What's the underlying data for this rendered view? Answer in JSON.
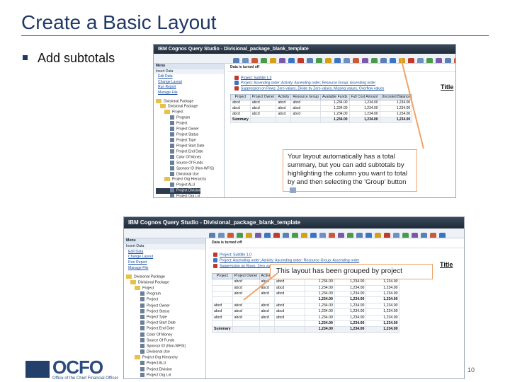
{
  "slide": {
    "title": "Create a Basic Layout",
    "bullet": "Add subtotals",
    "page_number": "10",
    "logo_text": "OCFO",
    "logo_subtitle": "Office of the Chief Financial Officer"
  },
  "app": {
    "window_title": "IBM Cognos Query Studio - Divisional_package_blank_template",
    "menu_label": "Menu",
    "menu_items": [
      "Insert Data",
      "Edit Data",
      "Change Layout",
      "Run Report",
      "Manage File"
    ],
    "tree": {
      "root": "Divisional Package",
      "folder": "Divisional Package",
      "project_folder": "Project",
      "items": [
        "Program",
        "Project",
        "Project Owner",
        "Project Status",
        "Project Type",
        "Project Start Date",
        "Project End Date",
        "Color Of Money",
        "Source Of Funds",
        "Sponsor ID (Non-WFIS)",
        "Divisional Use"
      ],
      "hierarchy": "Project Org Hierarchy",
      "hier_items": [
        "Project ALU",
        "Project Division",
        "Project Org Lvl"
      ]
    },
    "filter_note": "Data is turned off",
    "report_title": "Title",
    "links": {
      "project_subtitle": "Project: Subtitle 1.0",
      "project_sort": "Project: Ascending order; Activity: Ascending order; Resource Group: Ascending order",
      "suppression": "Suppression on Rows: Zero values, Divide by Zero values, Missing values, Overflow values"
    }
  },
  "top_report": {
    "columns": [
      "Project",
      "Project Owner",
      "Activity",
      "Resource Group",
      "Available Funds",
      "Full Cost Amount",
      "Uncosted Balance"
    ],
    "rows": [
      [
        "abcd",
        "abcd",
        "abcd",
        "abcd",
        "1,234.00",
        "1,234.00",
        "1,234.00"
      ],
      [
        "abcd",
        "abcd",
        "abcd",
        "abcd",
        "1,234.00",
        "1,234.00",
        "1,234.00"
      ],
      [
        "abcd",
        "abcd",
        "abcd",
        "abcd",
        "1,234.00",
        "1,234.00",
        "1,234.00"
      ]
    ],
    "summary_label": "Summary",
    "summary_values": [
      "1,234.00",
      "1,234.00",
      "1,234.00"
    ]
  },
  "bottom_report": {
    "columns": [
      "Project",
      "Project Owner",
      "Activity",
      "Resource Group",
      "Available Funds",
      "Full Cost Amount",
      "Uncosted Balance"
    ],
    "rows": [
      [
        "",
        "abcd",
        "abcd",
        "abcd",
        "1,234.00",
        "1,234.00",
        "1,234.00"
      ],
      [
        "",
        "abcd",
        "abcd",
        "abcd",
        "1,234.00",
        "1,234.00",
        "1,234.00"
      ],
      [
        "",
        "abcd",
        "abcd",
        "abcd",
        "1,234.00",
        "1,234.00",
        "1,234.00"
      ],
      [
        "",
        "",
        "",
        "",
        "1,234.00",
        "1,234.00",
        "1,234.00"
      ],
      [
        "abcd",
        "abcd",
        "abcd",
        "abcd",
        "1,234.00",
        "1,234.00",
        "1,234.00"
      ],
      [
        "abcd",
        "abcd",
        "abcd",
        "abcd",
        "1,234.00",
        "1,234.00",
        "1,234.00"
      ],
      [
        "abcd",
        "abcd",
        "abcd",
        "abcd",
        "1,234.00",
        "1,234.00",
        "1,234.00"
      ],
      [
        "",
        "",
        "",
        "",
        "1,234.00",
        "1,234.00",
        "1,234.00"
      ]
    ],
    "summary_label": "Summary",
    "summary_values": [
      "1,234.00",
      "1,234.00",
      "1,234.00"
    ]
  },
  "callouts": {
    "top": "Your layout automatically has a total summary, but you can add subtotals by highlighting the column you want to total by and then selecting the 'Group' button",
    "bottom": "This layout has been grouped by project"
  },
  "colors": {
    "title": "#1f3864",
    "callout_border": "#f0a36a",
    "pointer": "#f0a36a",
    "link": "#1a4fa0"
  }
}
